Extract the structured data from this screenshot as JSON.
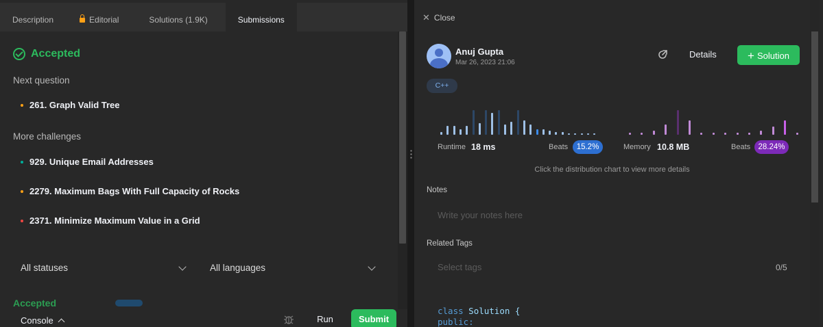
{
  "tabs": [
    {
      "label": "Description"
    },
    {
      "label": "Editorial"
    },
    {
      "label": "Solutions (1.9K)"
    },
    {
      "label": "Submissions"
    }
  ],
  "status": "Accepted",
  "next_question": {
    "label": "Next question",
    "items": [
      {
        "title": "261. Graph Valid Tree",
        "color": "#ffa116"
      }
    ]
  },
  "more_challenges": {
    "label": "More challenges",
    "items": [
      {
        "title": "929. Unique Email Addresses",
        "color": "#00af9b"
      },
      {
        "title": "2279. Maximum Bags With Full Capacity of Rocks",
        "color": "#ffa116"
      },
      {
        "title": "2371. Minimize Maximum Value in a Grid",
        "color": "#ef4743"
      }
    ]
  },
  "filters": {
    "status": "All statuses",
    "language": "All languages"
  },
  "bottom": {
    "console": "Console",
    "run": "Run",
    "submit": "Submit"
  },
  "panel": {
    "close": "Close",
    "user": "Anuj Gupta",
    "date": "Mar 26, 2023 21:06",
    "details": "Details",
    "solution": "Solution",
    "language": "C++"
  },
  "runtime": {
    "label": "Runtime",
    "value": "18 ms",
    "beats_label": "Beats",
    "beats": "15.2%",
    "color": "#2d6fd1"
  },
  "memory": {
    "label": "Memory",
    "value": "10.8 MB",
    "beats_label": "Beats",
    "beats": "28.24%",
    "color": "#7c2ab8"
  },
  "hint": "Click the distribution chart to view more details",
  "notes": {
    "label": "Notes",
    "placeholder": "Write your notes here"
  },
  "tags": {
    "label": "Related Tags",
    "placeholder": "Select tags",
    "count": "0/5"
  },
  "code": {
    "line1_kw": "class",
    "line1_rest": "Solution {",
    "line2": "public:"
  },
  "chart_data": [
    {
      "type": "bar",
      "title": "Runtime distribution",
      "values": [
        2,
        6,
        6,
        4,
        6,
        17,
        8,
        17,
        15,
        17,
        7,
        9,
        17,
        10,
        7,
        4,
        4,
        3,
        2,
        2,
        1,
        1,
        1,
        1,
        1
      ],
      "highlight_index": 15,
      "colors": {
        "normal": "#9ec0e6",
        "dim": "#2d4766",
        "highlight": "#3b8ced"
      }
    },
    {
      "type": "bar",
      "title": "Memory distribution",
      "values": [
        1,
        1,
        2,
        5,
        12,
        7,
        1,
        1,
        1,
        1,
        1,
        2,
        4,
        7,
        1
      ],
      "highlight_index": 13,
      "colors": {
        "normal": "#c08ad6",
        "dim": "#5a2f6e",
        "highlight": "#c860e8"
      }
    }
  ]
}
